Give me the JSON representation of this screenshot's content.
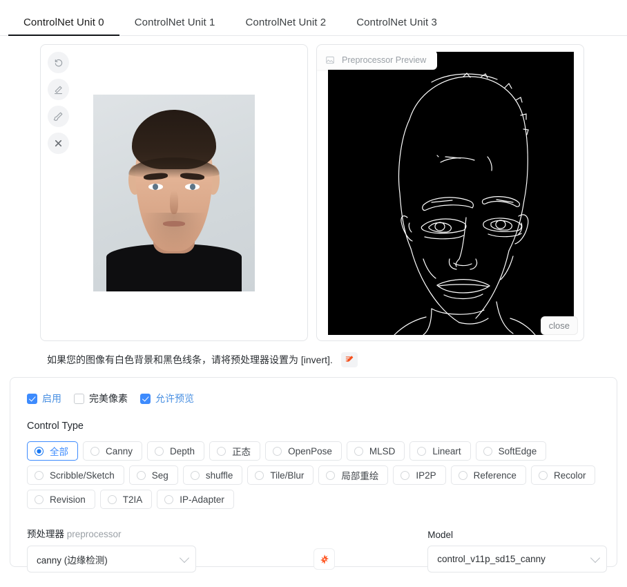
{
  "tabs": [
    {
      "label": "ControlNet Unit 0",
      "active": true
    },
    {
      "label": "ControlNet Unit 1",
      "active": false
    },
    {
      "label": "ControlNet Unit 2",
      "active": false
    },
    {
      "label": "ControlNet Unit 3",
      "active": false
    }
  ],
  "image_panel": {
    "tools": [
      {
        "name": "undo-icon",
        "title": "undo"
      },
      {
        "name": "eraser-icon",
        "title": "eraser"
      },
      {
        "name": "brush-icon",
        "title": "brush"
      },
      {
        "name": "close-icon",
        "title": "remove"
      }
    ],
    "photo_alt": "portrait photo of a man"
  },
  "preview": {
    "badge_label": "Preprocessor Preview",
    "badge_icon": "image-icon",
    "close_label": "close"
  },
  "hint": {
    "text": "如果您的图像有白色背景和黑色线条，请将预处理器设置为 [invert].",
    "icon": "edit-note-icon",
    "icon_color": "#f4511e"
  },
  "checkboxes": [
    {
      "label": "启用",
      "checked": true,
      "highlight": true
    },
    {
      "label": "完美像素",
      "checked": false,
      "highlight": false
    },
    {
      "label": "允许预览",
      "checked": true,
      "highlight": true
    }
  ],
  "control_type": {
    "title": "Control Type",
    "selected": "全部",
    "options": [
      "全部",
      "Canny",
      "Depth",
      "正态",
      "OpenPose",
      "MLSD",
      "Lineart",
      "SoftEdge",
      "Scribble/Sketch",
      "Seg",
      "shuffle",
      "Tile/Blur",
      "局部重绘",
      "IP2P",
      "Reference",
      "Recolor",
      "Revision",
      "T2IA",
      "IP-Adapter"
    ]
  },
  "preprocessor": {
    "label_cn": "预处理器",
    "label_en": "preprocessor",
    "value": "canny (边缘检测)"
  },
  "refresh_button": {
    "icon": "sparkle-burst-icon",
    "color": "#ff5724"
  },
  "model": {
    "label": "Model",
    "value": "control_v11p_sd15_canny"
  },
  "colors": {
    "accent_blue": "#3d8bfd",
    "link_blue": "#4a90e2",
    "active_tab_underline": "#111418",
    "panel_border": "#e5e7ea",
    "orange": "#ff5724"
  }
}
